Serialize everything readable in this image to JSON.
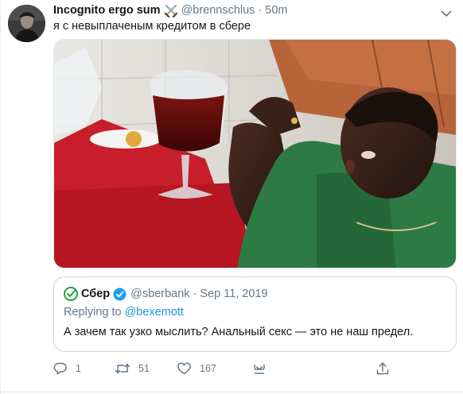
{
  "tweet": {
    "author_name": "Incognito ergo sum",
    "author_handle": "@brennschlus",
    "separator": "·",
    "time": "50m",
    "text": "я с невыплаченым кредитом в сбере"
  },
  "quoted": {
    "name": "Сбер",
    "handle": "@sberbank",
    "separator": "·",
    "date": "Sep 11, 2019",
    "replying_prefix": "Replying to ",
    "replying_handle": "@bexemott",
    "text": "А зачем так узко мыслить? Анальный секс — это не наш предел."
  },
  "actions": {
    "reply_count": "1",
    "retweet_count": "51",
    "like_count": "167"
  },
  "colors": {
    "secondary_text": "#657786",
    "link": "#1b95e0",
    "verified": "#1da1f2",
    "sber_green": "#21a038"
  },
  "icons": [
    "crossed-swords-icon",
    "chevron-down-icon",
    "sber-logo-icon",
    "verified-badge-icon",
    "reply-icon",
    "retweet-icon",
    "like-icon",
    "share-icon"
  ]
}
